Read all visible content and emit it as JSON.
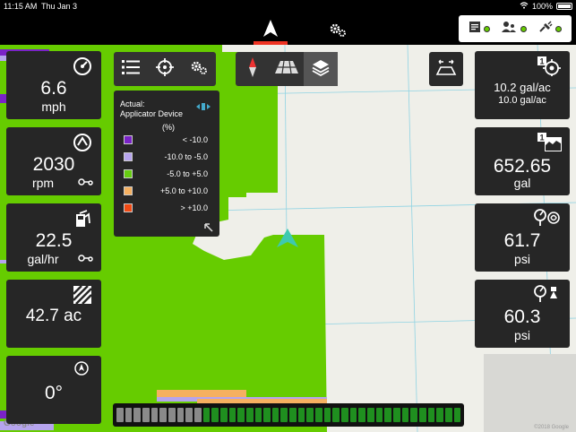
{
  "status_bar": {
    "time": "11:15 AM",
    "date": "Thu Jan 3",
    "battery": "100%"
  },
  "toolbar": {
    "nav_icon": "navigation-arrow-icon",
    "settings_icon": "gears-icon",
    "status_icons": [
      "document-icon",
      "users-icon",
      "connection-plug-icon"
    ]
  },
  "left_tiles": [
    {
      "value": "6.6",
      "unit": "mph",
      "icon": "speedometer-icon"
    },
    {
      "value": "2030",
      "unit": "rpm",
      "icon": "engine-rpm-icon"
    },
    {
      "value": "22.5",
      "unit": "gal/hr",
      "icon": "fuel-pump-icon"
    },
    {
      "value": "42.7 ac",
      "unit": "",
      "icon": "area-hatch-icon"
    },
    {
      "value": "0°",
      "unit": "",
      "icon": "compass-heading-icon"
    }
  ],
  "right_tiles": [
    {
      "value": "10.2 gal/ac",
      "unit": "10.0 gal/ac",
      "icon": "target-rate-icon",
      "badge": "1"
    },
    {
      "value": "652.65",
      "unit": "gal",
      "icon": "tank-level-icon",
      "badge": "1"
    },
    {
      "value": "61.7",
      "unit": "psi",
      "icon": "pressure-pump-icon"
    },
    {
      "value": "60.3",
      "unit": "psi",
      "icon": "pressure-nozzle-icon"
    }
  ],
  "map_toolbar": {
    "group1": [
      "layers-list-icon",
      "crosshair-icon",
      "gears-icon"
    ],
    "group2": [
      "compass-north-icon",
      "perspective-grid-icon",
      "layers-icon"
    ],
    "swath_icon": "swath-width-icon"
  },
  "legend": {
    "title_line1": "Actual:",
    "title_line2": "Applicator Device",
    "unit": "(%)",
    "items": [
      {
        "label": "< -10.0",
        "color": "#7a22c8"
      },
      {
        "label": "-10.0 to -5.0",
        "color": "#b6a4ee"
      },
      {
        "label": "-5.0 to +5.0",
        "color": "#66cc11"
      },
      {
        "label": "+5.0 to +10.0",
        "color": "#f5b060"
      },
      {
        "label": "> +10.0",
        "color": "#f04a14"
      }
    ]
  },
  "coverage": {
    "total_sections": 40,
    "off_sections": 10,
    "on_color": "#1f8f1f",
    "off_color": "#8a8a8a"
  },
  "map": {
    "google_label": "Google",
    "copyright": "©2018 Google",
    "field_color": "#66cc00"
  }
}
